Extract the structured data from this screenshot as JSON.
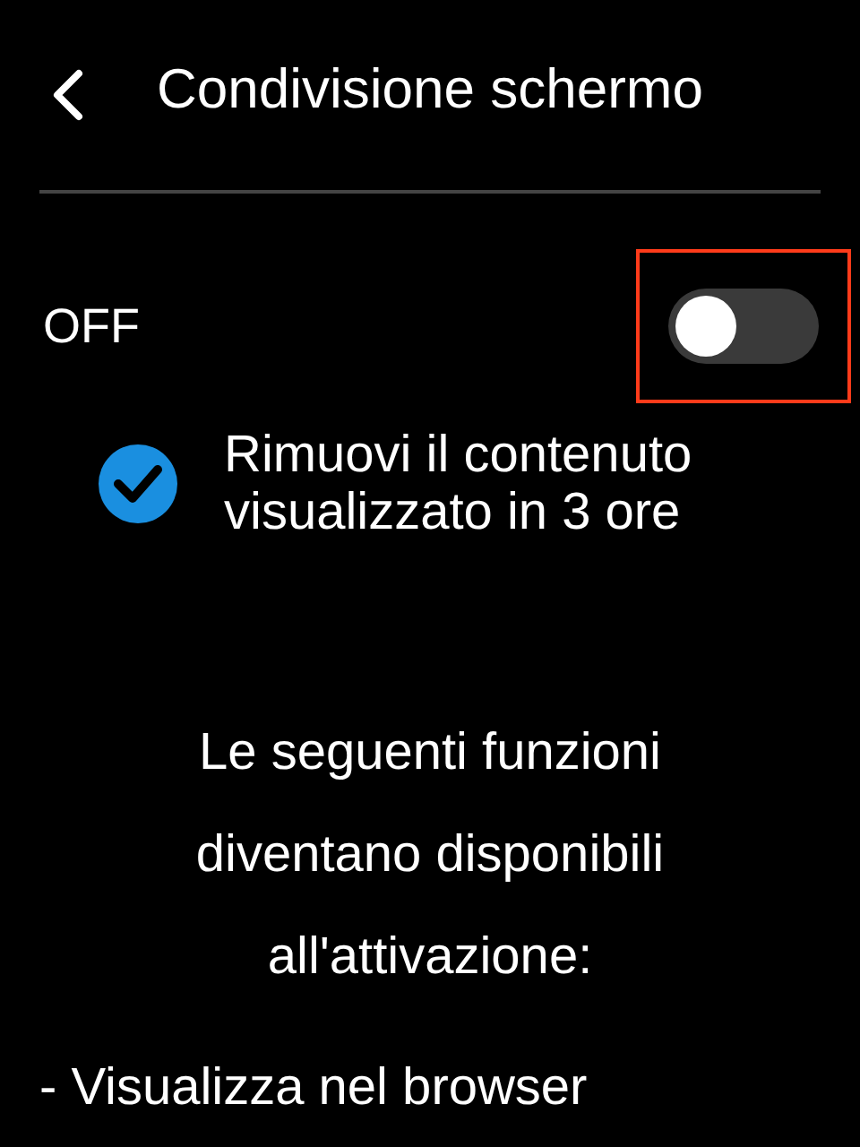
{
  "header": {
    "title": "Condivisione schermo"
  },
  "toggle": {
    "label": "OFF",
    "on": false,
    "highlighted": true
  },
  "checkbox": {
    "label": "Rimuovi il contenuto visualizzato in 3 ore",
    "checked": true
  },
  "description": "Le seguenti funzioni diventano disponibili all'attivazione:",
  "features": [
    "- Visualizza nel browser"
  ]
}
